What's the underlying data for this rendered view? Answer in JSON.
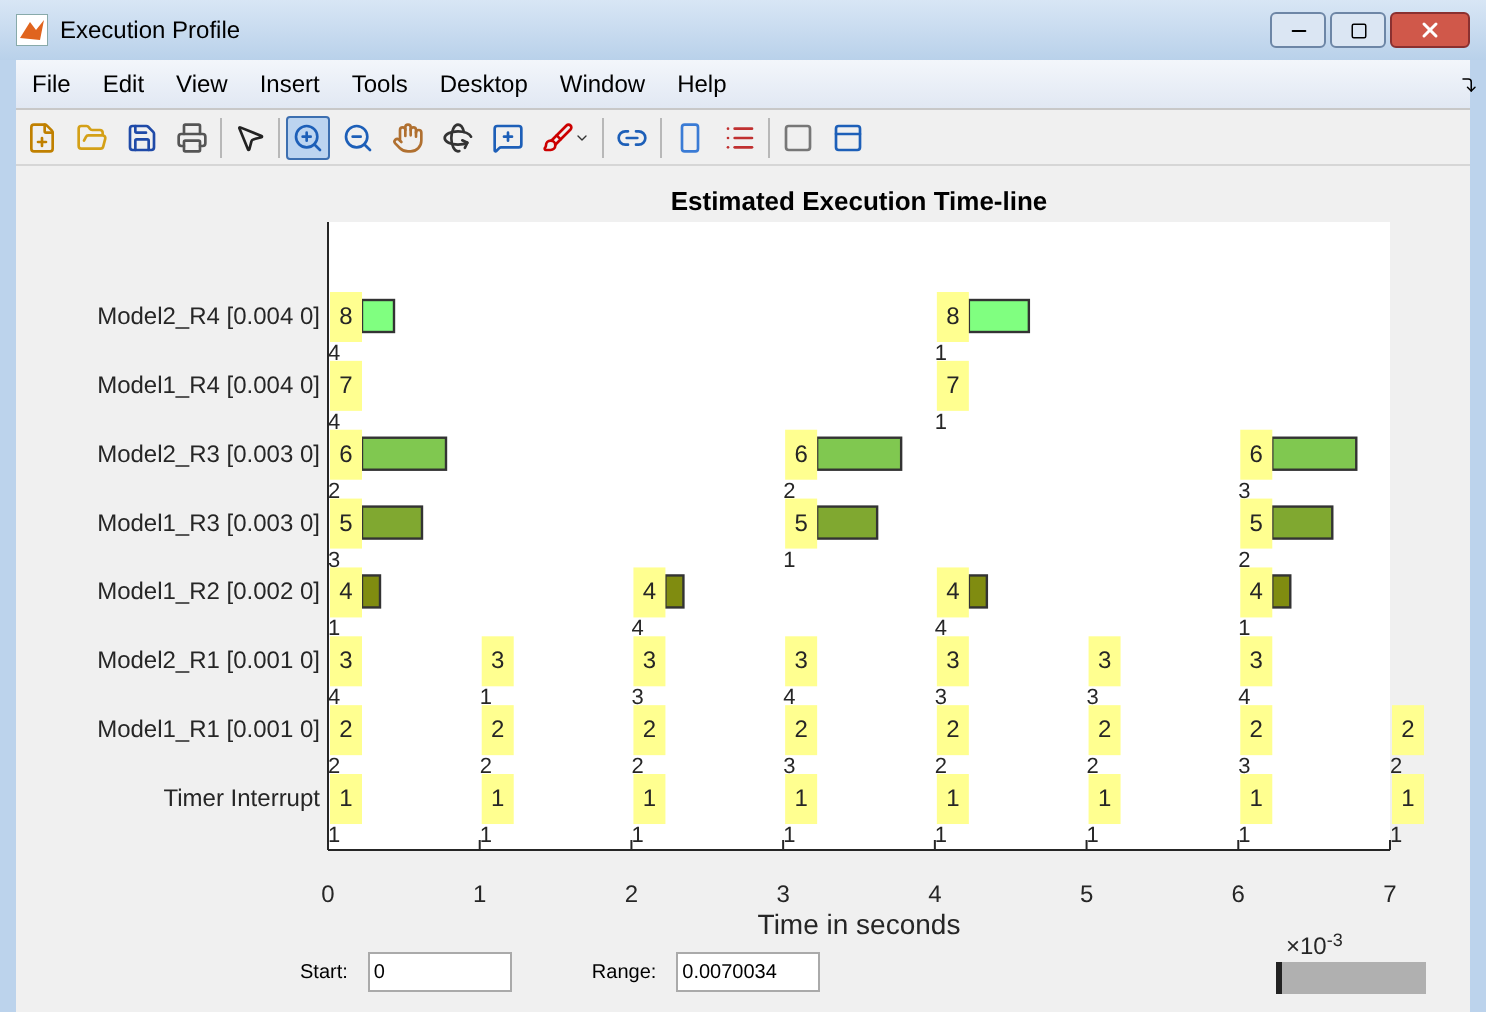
{
  "window": {
    "title": "Execution Profile"
  },
  "menu": [
    "File",
    "Edit",
    "View",
    "Insert",
    "Tools",
    "Desktop",
    "Window",
    "Help"
  ],
  "toolbar": [
    {
      "selected": false
    },
    {
      "selected": false
    },
    {
      "selected": false
    },
    {
      "selected": false
    },
    {
      "selected": false
    },
    {
      "selected": true
    },
    {
      "selected": false
    },
    {
      "selected": false
    },
    {
      "selected": false
    },
    {
      "selected": false
    },
    {
      "selected": false
    },
    {
      "selected": false
    },
    {
      "selected": false
    },
    {
      "selected": false
    },
    {
      "selected": false
    },
    {
      "selected": false
    }
  ],
  "timeline": {
    "title": "Estimated Execution Time-line",
    "xlabel": "Time in seconds",
    "ticks": [
      "0",
      "1",
      "2",
      "3",
      "4",
      "5",
      "6",
      "7"
    ],
    "exponent_label": "×10$^{-3}$",
    "rows": [
      {
        "label": "Model2_R4 [0.004 0]",
        "color": "#80ff80",
        "slots": [
          {
            "kind": "short",
            "tag": "8",
            "note": "4"
          },
          {
            "kind": "empty"
          },
          {
            "kind": "empty"
          },
          {
            "kind": "empty"
          },
          {
            "kind": "medium",
            "tag": "8",
            "note": "1"
          },
          {
            "kind": "empty"
          },
          {
            "kind": "empty"
          },
          {
            "kind": "empty"
          }
        ]
      },
      {
        "label": "Model1_R4 [0.004 0]",
        "slots": [
          {
            "kind": "marker",
            "tag": "7",
            "note": "4"
          },
          {
            "kind": "empty"
          },
          {
            "kind": "empty"
          },
          {
            "kind": "empty"
          },
          {
            "kind": "marker",
            "tag": "7",
            "note": "1"
          },
          {
            "kind": "empty"
          },
          {
            "kind": "empty"
          },
          {
            "kind": "empty"
          }
        ]
      },
      {
        "label": "Model2_R3 [0.003 0]",
        "color": "#80c850",
        "slots": [
          {
            "kind": "long",
            "tag": "6",
            "note": "2"
          },
          {
            "kind": "empty"
          },
          {
            "kind": "empty"
          },
          {
            "kind": "long",
            "tag": "6",
            "note": "2"
          },
          {
            "kind": "empty"
          },
          {
            "kind": "empty"
          },
          {
            "kind": "long",
            "tag": "6",
            "note": "3"
          },
          {
            "kind": "empty"
          }
        ]
      },
      {
        "label": "Model1_R3 [0.003 0]",
        "color": "#80a830",
        "slots": [
          {
            "kind": "medium",
            "tag": "5",
            "note": "3"
          },
          {
            "kind": "empty"
          },
          {
            "kind": "empty"
          },
          {
            "kind": "medium",
            "tag": "5",
            "note": "1"
          },
          {
            "kind": "empty"
          },
          {
            "kind": "empty"
          },
          {
            "kind": "medium",
            "tag": "5",
            "note": "2"
          },
          {
            "kind": "empty"
          }
        ]
      },
      {
        "label": "Model1_R2 [0.002 0]",
        "color": "#808c10",
        "slots": [
          {
            "kind": "tiny",
            "tag": "4",
            "note": "1"
          },
          {
            "kind": "empty"
          },
          {
            "kind": "tiny",
            "tag": "4",
            "note": "4"
          },
          {
            "kind": "empty"
          },
          {
            "kind": "tiny",
            "tag": "4",
            "note": "4"
          },
          {
            "kind": "empty"
          },
          {
            "kind": "tiny",
            "tag": "4",
            "note": "1"
          },
          {
            "kind": "empty"
          }
        ]
      },
      {
        "label": "Model2_R1 [0.001 0]",
        "slots": [
          {
            "kind": "marker",
            "tag": "3",
            "note": "4"
          },
          {
            "kind": "marker",
            "tag": "3",
            "note": "1"
          },
          {
            "kind": "marker",
            "tag": "3",
            "note": "3"
          },
          {
            "kind": "marker",
            "tag": "3",
            "note": "4"
          },
          {
            "kind": "marker",
            "tag": "3",
            "note": "3"
          },
          {
            "kind": "marker",
            "tag": "3",
            "note": "3"
          },
          {
            "kind": "marker",
            "tag": "3",
            "note": "4"
          },
          {
            "kind": "empty"
          }
        ]
      },
      {
        "label": "Model1_R1 [0.001 0]",
        "slots": [
          {
            "kind": "marker",
            "tag": "2",
            "note": "2"
          },
          {
            "kind": "marker",
            "tag": "2",
            "note": "2"
          },
          {
            "kind": "marker",
            "tag": "2",
            "note": "2"
          },
          {
            "kind": "marker",
            "tag": "2",
            "note": "3"
          },
          {
            "kind": "marker",
            "tag": "2",
            "note": "2"
          },
          {
            "kind": "marker",
            "tag": "2",
            "note": "2"
          },
          {
            "kind": "marker",
            "tag": "2",
            "note": "3"
          },
          {
            "kind": "marker",
            "tag": "2",
            "note": "2"
          }
        ]
      },
      {
        "label": "Timer Interrupt",
        "slots": [
          {
            "kind": "marker",
            "tag": "1",
            "note": "1"
          },
          {
            "kind": "marker",
            "tag": "1",
            "note": "1"
          },
          {
            "kind": "marker",
            "tag": "1",
            "note": "1"
          },
          {
            "kind": "marker",
            "tag": "1",
            "note": "1"
          },
          {
            "kind": "marker",
            "tag": "1",
            "note": "1"
          },
          {
            "kind": "marker",
            "tag": "1",
            "note": "1"
          },
          {
            "kind": "marker",
            "tag": "1",
            "note": "1"
          },
          {
            "kind": "marker",
            "tag": "1",
            "note": "1"
          }
        ]
      }
    ]
  },
  "controls": {
    "start": {
      "label": "Start:",
      "value": "0"
    },
    "range": {
      "label": "Range:",
      "value": "0.0070034"
    },
    "slider": {
      "level": 0
    }
  }
}
